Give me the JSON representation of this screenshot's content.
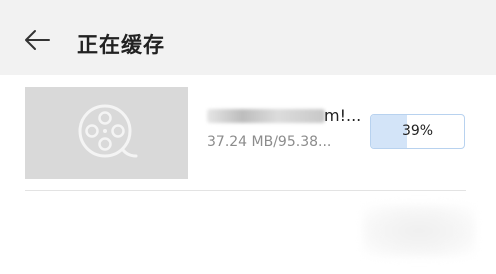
{
  "header": {
    "title": "正在缓存",
    "back_icon": "arrow-left-icon"
  },
  "download_item": {
    "thumbnail_icon": "film-reel-icon",
    "name_visible": "m!...",
    "size_text": "37.24 MB/95.38...",
    "progress_percent": 39,
    "progress_label": "39%"
  },
  "colors": {
    "header_bg": "#f2f2f2",
    "thumbnail_bg": "#d9d9d9",
    "progress_fill": "#d3e4f8",
    "progress_border": "#b8d2ef"
  }
}
